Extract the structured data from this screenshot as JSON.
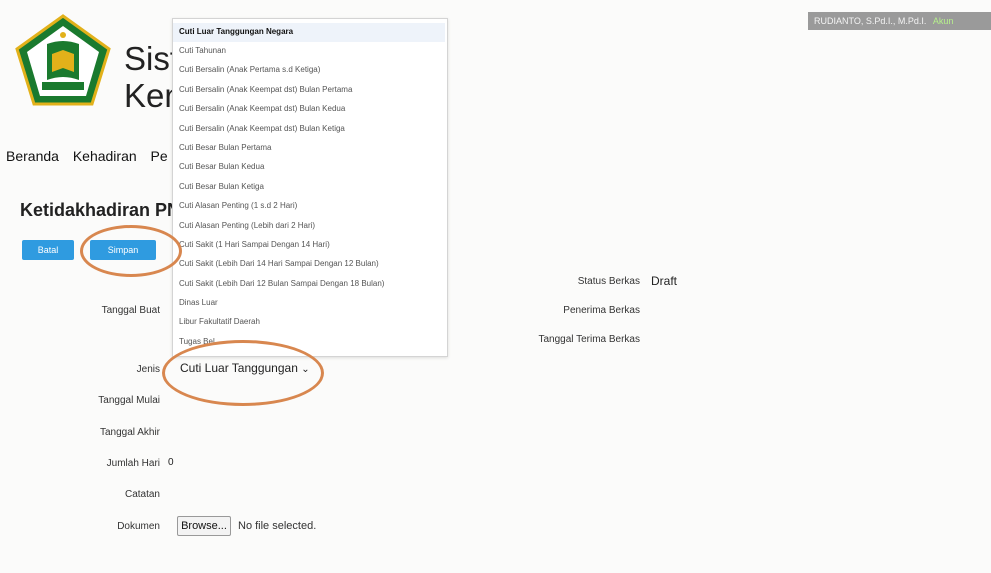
{
  "header": {
    "user_name": "RUDIANTO, S.Pd.I., M.Pd.I.",
    "user_link": "Akun",
    "app_title_line1": "Siste",
    "app_title_line2": "Kem"
  },
  "nav": {
    "items": [
      "Beranda",
      "Kehadiran",
      "Pe"
    ]
  },
  "page": {
    "title": "Ketidakhadiran PN"
  },
  "buttons": {
    "cancel": "Batal",
    "save": "Simpan"
  },
  "form": {
    "tanggal_buat_label": "Tanggal Buat",
    "jenis_label": "Jenis",
    "jenis_value": "Cuti Luar Tanggungan",
    "tanggal_mulai_label": "Tanggal Mulai",
    "tanggal_akhir_label": "Tanggal Akhir",
    "jumlah_hari_label": "Jumlah Hari",
    "jumlah_hari_value": "0",
    "catatan_label": "Catatan",
    "dokumen_label": "Dokumen",
    "browse_label": "Browse...",
    "file_status": "No file selected."
  },
  "status": {
    "status_berkas_label": "Status Berkas",
    "status_berkas_value": "Draft",
    "penerima_berkas_label": "Penerima Berkas",
    "tanggal_terima_label": "Tanggal Terima Berkas"
  },
  "dropdown": {
    "options": [
      "Cuti Luar Tanggungan Negara",
      "Cuti Tahunan",
      "Cuti Bersalin (Anak Pertama s.d Ketiga)",
      "Cuti Bersalin (Anak Keempat dst) Bulan Pertama",
      "Cuti Bersalin (Anak Keempat dst) Bulan Kedua",
      "Cuti Bersalin (Anak Keempat dst) Bulan Ketiga",
      "Cuti Besar Bulan Pertama",
      "Cuti Besar Bulan Kedua",
      "Cuti Besar Bulan Ketiga",
      "Cuti Alasan Penting (1 s.d 2 Hari)",
      "Cuti Alasan Penting (Lebih dari 2 Hari)",
      "Cuti Sakit (1 Hari Sampai Dengan 14 Hari)",
      "Cuti Sakit (Lebih Dari 14 Hari Sampai Dengan 12 Bulan)",
      "Cuti Sakit (Lebih Dari 12 Bulan Sampai Dengan 18 Bulan)",
      "Dinas Luar",
      "Libur Fakultatif Daerah",
      "Tugas Bel"
    ],
    "selected_index": 0
  },
  "colors": {
    "button": "#2f9be0",
    "annotation": "#d8874f",
    "logo_green": "#1a7a2e",
    "logo_gold": "#e2b11a"
  },
  "icons": {
    "logo": "kemenag-logo",
    "select_caret": "chevron-down-icon"
  }
}
